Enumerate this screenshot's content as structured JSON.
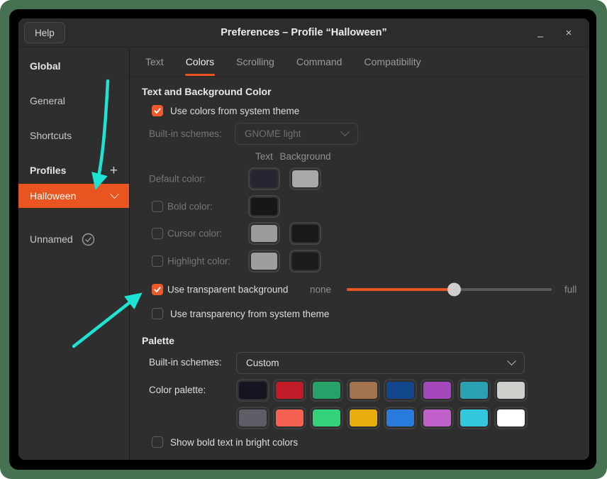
{
  "window": {
    "title": "Preferences – Profile “Halloween”",
    "help_label": "Help",
    "minimize_glyph": "–",
    "close_glyph": "×"
  },
  "sidebar": {
    "items": [
      {
        "label": "Global"
      },
      {
        "label": "General"
      },
      {
        "label": "Shortcuts"
      },
      {
        "label": "Profiles",
        "add_icon": "+"
      },
      {
        "label": "Halloween",
        "selected": true
      },
      {
        "label": "Unnamed",
        "status_icon": "check-circle"
      }
    ]
  },
  "tabs": {
    "items": [
      {
        "label": "Text"
      },
      {
        "label": "Colors",
        "active": true
      },
      {
        "label": "Scrolling"
      },
      {
        "label": "Command"
      },
      {
        "label": "Compatibility"
      }
    ]
  },
  "text_bg": {
    "heading": "Text and Background Color",
    "use_system_theme_label": "Use colors from system theme",
    "use_system_theme_checked": true,
    "builtin_label": "Built-in schemes:",
    "builtin_value": "GNOME light",
    "builtin_disabled": true,
    "col_text": "Text",
    "col_background": "Background",
    "rows": [
      {
        "label": "Default color:",
        "checkbox": false,
        "text_color": "#252632",
        "bg_color": "#a8a8a8"
      },
      {
        "label": "Bold color:",
        "checkbox": true,
        "checked": false,
        "text_color": "#171717"
      },
      {
        "label": "Cursor color:",
        "checkbox": true,
        "checked": false,
        "text_color": "#9b9b9b",
        "bg_color": "#181818"
      },
      {
        "label": "Highlight color:",
        "checkbox": true,
        "checked": false,
        "text_color": "#9e9e9e",
        "bg_color": "#1c1c1c"
      }
    ],
    "transparent_label": "Use transparent background",
    "transparent_checked": true,
    "slider": {
      "min_label": "none",
      "max_label": "full",
      "fill": "52.6%"
    },
    "transparency_theme_label": "Use transparency from system theme",
    "transparency_theme_checked": false
  },
  "palette": {
    "heading": "Palette",
    "builtin_label": "Built-in schemes:",
    "builtin_value": "Custom",
    "palette_label": "Color palette:",
    "rows": [
      [
        "#171421",
        "#c01c28",
        "#26a269",
        "#a2734c",
        "#12488b",
        "#a347ba",
        "#2aa1b3",
        "#d0cfcc"
      ],
      [
        "#5e5c64",
        "#f66151",
        "#33d17a",
        "#e9ad0c",
        "#2a7bde",
        "#c061cb",
        "#33c7de",
        "#ffffff"
      ]
    ],
    "show_bold_label": "Show bold text in bright colors",
    "show_bold_checked": false
  },
  "annotations": {
    "color": "#1ee3d4"
  },
  "colors": {
    "accent": "#e95420",
    "titlebar": "#2c2c2c",
    "window_bg": "#2e2e2e",
    "desktop": "#477251"
  }
}
